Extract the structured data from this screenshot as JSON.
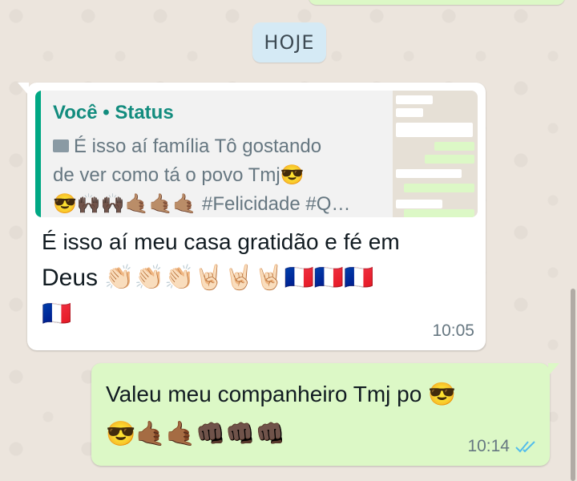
{
  "date_chip": "HOJE",
  "incoming": {
    "quote_author": "Você • Status",
    "quote_line1": "É isso aí família Tô gostando",
    "quote_line2": "de ver como tá o povo Tmj😎",
    "quote_line3": "😎🙌🏿🙌🏿🤙🏽🤙🏽🤙🏽 #Felicidade #Q…",
    "text_line1": "É isso aí meu casa gratidão e fé em",
    "text_line2": "Deus 👏🏻👏🏻👏🏻🤘🏻🤘🏻🤘🏻🇫🇷🇫🇷🇫🇷",
    "text_line3": "🇫🇷",
    "time": "10:05"
  },
  "outgoing": {
    "text_line1": "Valeu meu companheiro Tmj po 😎",
    "text_line2": "😎🤙🏾🤙🏾👊🏿👊🏿👊🏿",
    "time": "10:14",
    "status": "read"
  },
  "colors": {
    "accent": "#128c7e",
    "outgoing_bg": "#dcf8c6",
    "read_ticks": "#53bdeb"
  },
  "icons": {
    "quote_media": "image-icon",
    "status": "double-check-icon"
  }
}
